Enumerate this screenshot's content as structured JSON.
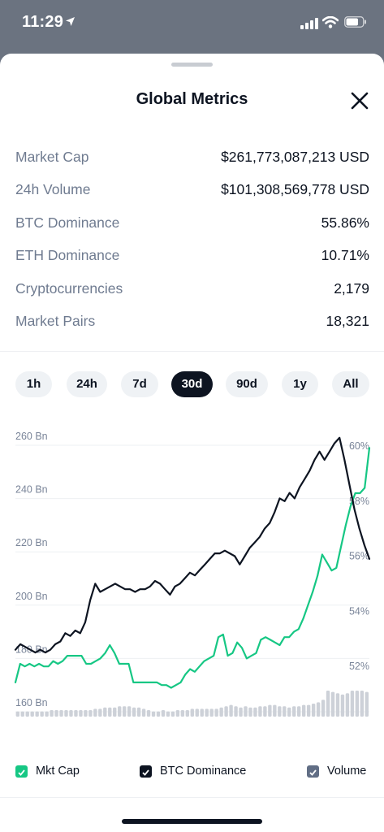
{
  "status_bar": {
    "time": "11:29"
  },
  "sheet": {
    "title": "Global Metrics"
  },
  "metrics": [
    {
      "label": "Market Cap",
      "value": "$261,773,087,213 USD"
    },
    {
      "label": "24h Volume",
      "value": "$101,308,569,778 USD"
    },
    {
      "label": "BTC Dominance",
      "value": "55.86%"
    },
    {
      "label": "ETH Dominance",
      "value": "10.71%"
    },
    {
      "label": "Cryptocurrencies",
      "value": "2,179"
    },
    {
      "label": "Market Pairs",
      "value": "18,321"
    }
  ],
  "range_tabs": [
    {
      "label": "1h",
      "selected": false
    },
    {
      "label": "24h",
      "selected": false
    },
    {
      "label": "7d",
      "selected": false
    },
    {
      "label": "30d",
      "selected": true
    },
    {
      "label": "90d",
      "selected": false
    },
    {
      "label": "1y",
      "selected": false
    },
    {
      "label": "All",
      "selected": false
    }
  ],
  "legend": [
    {
      "label": "Mkt Cap",
      "color": "#16c784"
    },
    {
      "label": "BTC Dominance",
      "color": "#0d1421"
    },
    {
      "label": "Volume",
      "color": "#616e85"
    }
  ],
  "chart_data": {
    "type": "line",
    "y_left_ticks": [
      "260 Bn",
      "240 Bn",
      "220 Bn",
      "200 Bn",
      "180 Bn",
      "160 Bn"
    ],
    "y_right_ticks": [
      "60%",
      "58%",
      "56%",
      "54%",
      "52%"
    ],
    "y_left_range": [
      160,
      262
    ],
    "y_right_range": [
      51.3,
      60.3
    ],
    "grid": true,
    "series": [
      {
        "name": "Mkt Cap",
        "axis": "left",
        "color": "#16c784",
        "values": [
          171,
          178,
          177,
          178,
          177,
          178,
          177,
          177,
          179,
          178,
          179,
          181,
          181,
          181,
          181,
          178,
          178,
          179,
          180,
          182,
          185,
          182,
          178,
          178,
          178,
          171,
          171,
          171,
          171,
          171,
          171,
          170,
          170,
          169,
          170,
          171,
          174,
          176,
          175,
          177,
          179,
          180,
          181,
          188,
          189,
          181,
          182,
          186,
          184,
          180,
          181,
          182,
          187,
          188,
          187,
          186,
          185,
          188,
          188,
          190,
          191,
          195,
          200,
          205,
          211,
          219,
          216,
          213,
          214,
          222,
          230,
          237,
          242,
          242,
          244,
          259
        ]
      },
      {
        "name": "BTC Dominance",
        "axis": "right",
        "color": "#0d1421",
        "values": [
          52.6,
          52.8,
          52.7,
          52.6,
          52.5,
          52.6,
          52.5,
          52.6,
          52.8,
          52.9,
          53.2,
          53.1,
          53.3,
          53.2,
          53.6,
          54.4,
          55.0,
          54.7,
          54.8,
          54.9,
          55.0,
          54.9,
          54.8,
          54.8,
          54.7,
          54.8,
          54.8,
          54.9,
          55.1,
          55.0,
          54.8,
          54.6,
          54.9,
          55.0,
          55.2,
          55.4,
          55.3,
          55.5,
          55.7,
          55.9,
          56.1,
          56.1,
          56.2,
          56.1,
          56.0,
          55.7,
          56.0,
          56.3,
          56.5,
          56.7,
          57.0,
          57.2,
          57.6,
          58.1,
          58.0,
          58.3,
          58.1,
          58.5,
          58.8,
          59.1,
          59.5,
          59.8,
          59.5,
          59.8,
          60.1,
          60.3,
          59.5,
          58.6,
          57.7,
          57.0,
          56.4,
          55.9
        ]
      },
      {
        "name": "Volume",
        "axis": "bottom",
        "color": "#cdd1d8",
        "values": [
          0.2,
          0.2,
          0.2,
          0.2,
          0.2,
          0.2,
          0.2,
          0.25,
          0.25,
          0.25,
          0.25,
          0.25,
          0.25,
          0.25,
          0.25,
          0.25,
          0.3,
          0.3,
          0.35,
          0.35,
          0.35,
          0.4,
          0.4,
          0.4,
          0.35,
          0.35,
          0.3,
          0.25,
          0.2,
          0.2,
          0.25,
          0.2,
          0.2,
          0.25,
          0.25,
          0.25,
          0.3,
          0.3,
          0.3,
          0.3,
          0.3,
          0.3,
          0.35,
          0.4,
          0.45,
          0.4,
          0.35,
          0.4,
          0.35,
          0.35,
          0.4,
          0.4,
          0.45,
          0.45,
          0.4,
          0.4,
          0.35,
          0.4,
          0.4,
          0.45,
          0.45,
          0.5,
          0.55,
          0.65,
          1.0,
          0.95,
          0.9,
          0.85,
          0.9,
          1.0,
          1.0,
          1.0,
          0.95
        ]
      }
    ]
  }
}
